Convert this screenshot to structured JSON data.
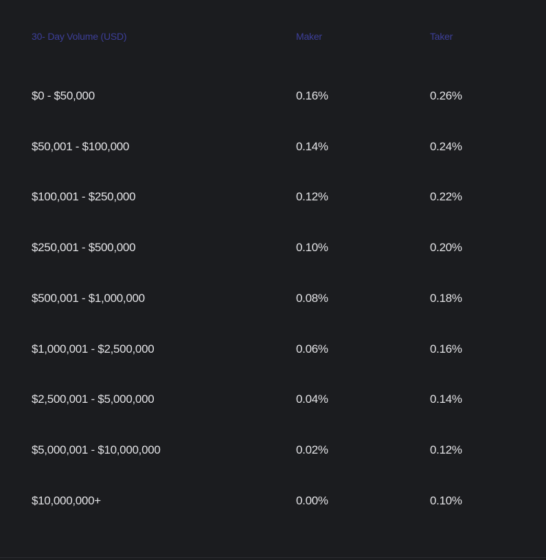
{
  "colors": {
    "background": "#1b1c1f",
    "header_text": "#3d3f9a",
    "body_text": "#e3e3e6"
  },
  "table": {
    "headers": {
      "volume": "30- Day Volume (USD)",
      "maker": "Maker",
      "taker": "Taker"
    },
    "rows": [
      {
        "volume": "$0 - $50,000",
        "maker": "0.16%",
        "taker": "0.26%"
      },
      {
        "volume": "$50,001 - $100,000",
        "maker": "0.14%",
        "taker": "0.24%"
      },
      {
        "volume": "$100,001 - $250,000",
        "maker": "0.12%",
        "taker": "0.22%"
      },
      {
        "volume": "$250,001 - $500,000",
        "maker": "0.10%",
        "taker": "0.20%"
      },
      {
        "volume": "$500,001 - $1,000,000",
        "maker": "0.08%",
        "taker": "0.18%"
      },
      {
        "volume": "$1,000,001 - $2,500,000",
        "maker": "0.06%",
        "taker": "0.16%"
      },
      {
        "volume": "$2,500,001 - $5,000,000",
        "maker": "0.04%",
        "taker": "0.14%"
      },
      {
        "volume": "$5,000,001 - $10,000,000",
        "maker": "0.02%",
        "taker": "0.12%"
      },
      {
        "volume": "$10,000,000+",
        "maker": "0.00%",
        "taker": "0.10%"
      }
    ]
  }
}
